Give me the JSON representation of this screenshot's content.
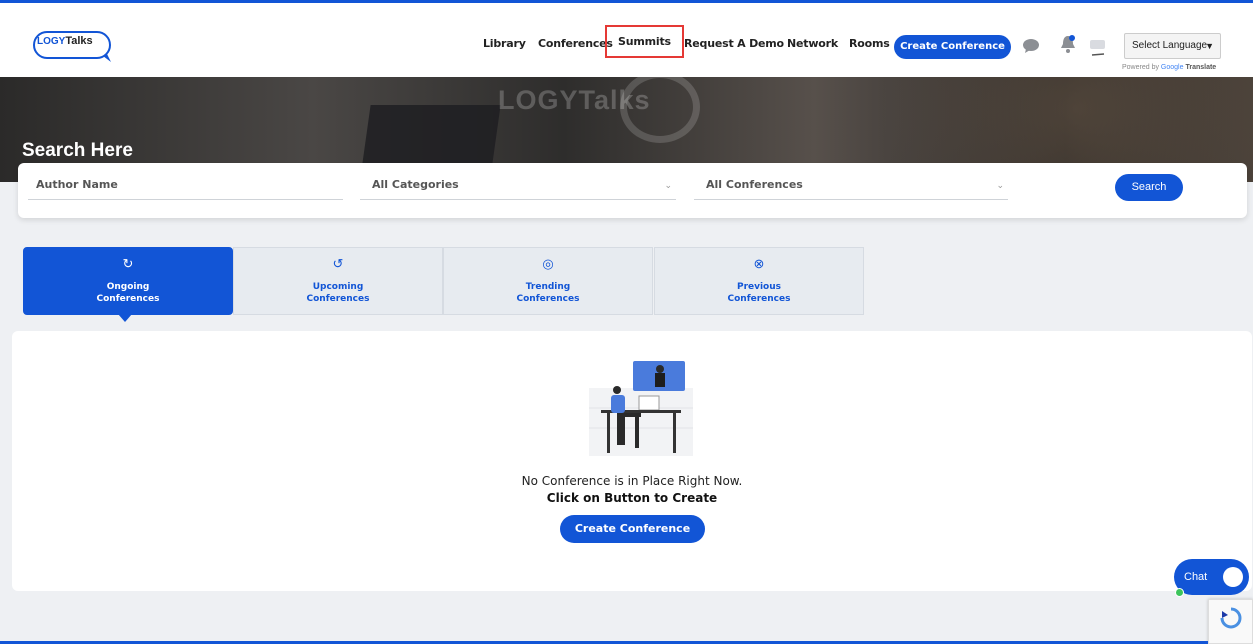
{
  "header": {
    "logo": {
      "part1": "LOGY",
      "part2": "Talks"
    },
    "nav": [
      {
        "label": "Library"
      },
      {
        "label": "Conferences"
      },
      {
        "label": "Summits"
      },
      {
        "label": "Request A Demo"
      },
      {
        "label": "Network"
      },
      {
        "label": "Rooms"
      }
    ],
    "create_button": "Create Conference",
    "icons": [
      "chat-icon",
      "bell-icon",
      "avatar"
    ],
    "language_select": "Select Language",
    "powered_by": {
      "prefix": "Powered by",
      "google": "Google",
      "suffix": "Translate"
    }
  },
  "hero": {
    "watermark": "LOGYTalks",
    "title": "Search Here"
  },
  "search": {
    "author_placeholder": "Author Name",
    "category_value": "All Categories",
    "conference_value": "All Conferences",
    "button": "Search"
  },
  "tabs": [
    {
      "line1": "Ongoing",
      "line2": "Conferences",
      "icon": "refresh-icon",
      "active": true
    },
    {
      "line1": "Upcoming",
      "line2": "Conferences",
      "icon": "history-icon",
      "active": false
    },
    {
      "line1": "Trending",
      "line2": "Conferences",
      "icon": "trending-icon",
      "active": false
    },
    {
      "line1": "Previous",
      "line2": "Conferences",
      "icon": "previous-icon",
      "active": false
    }
  ],
  "empty_state": {
    "message": "No Conference is in Place Right Now.",
    "cta_text": "Click on Button to Create",
    "button": "Create Conference"
  },
  "chat": {
    "label": "Chat"
  },
  "colors": {
    "accent": "#1255d6",
    "highlight_border": "#e53935"
  }
}
